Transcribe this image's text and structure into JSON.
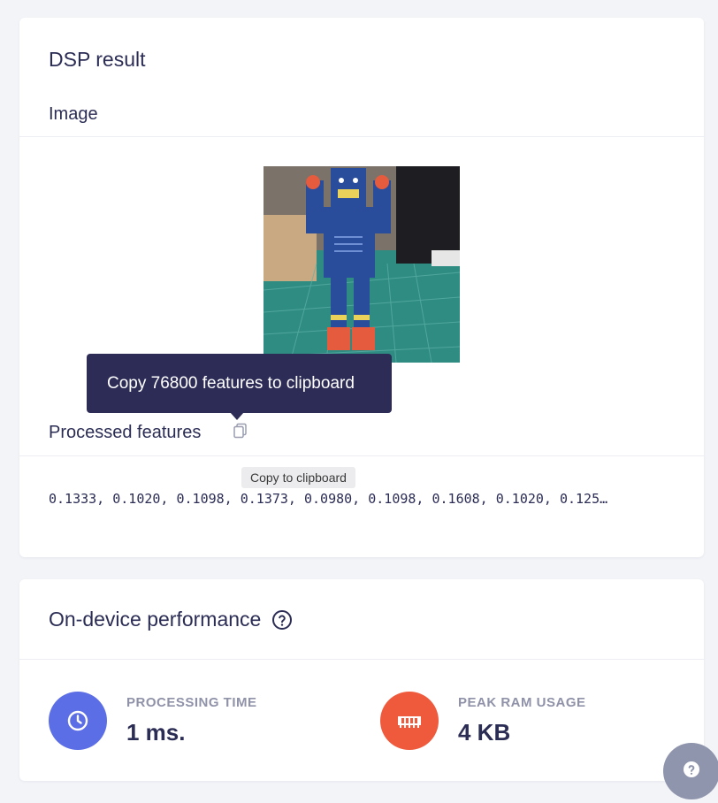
{
  "dsp": {
    "title": "DSP result",
    "image_label": "Image",
    "tooltip": "Copy 76800 features to clipboard",
    "processed_label": "Processed features",
    "copy_tip": "Copy to clipboard",
    "features_text": "0.1333, 0.1020, 0.1098, 0.1373, 0.0980, 0.1098, 0.1608, 0.1020, 0.125…"
  },
  "performance": {
    "title": "On-device performance",
    "processing": {
      "label": "PROCESSING TIME",
      "value": "1 ms.",
      "icon": "clock-icon",
      "color": "#5b6ee6"
    },
    "ram": {
      "label": "PEAK RAM USAGE",
      "value": "4 KB",
      "icon": "memory-icon",
      "color": "#ef5a3c"
    }
  },
  "help_fab": {
    "icon": "question-icon",
    "color": "#8f95ad"
  }
}
